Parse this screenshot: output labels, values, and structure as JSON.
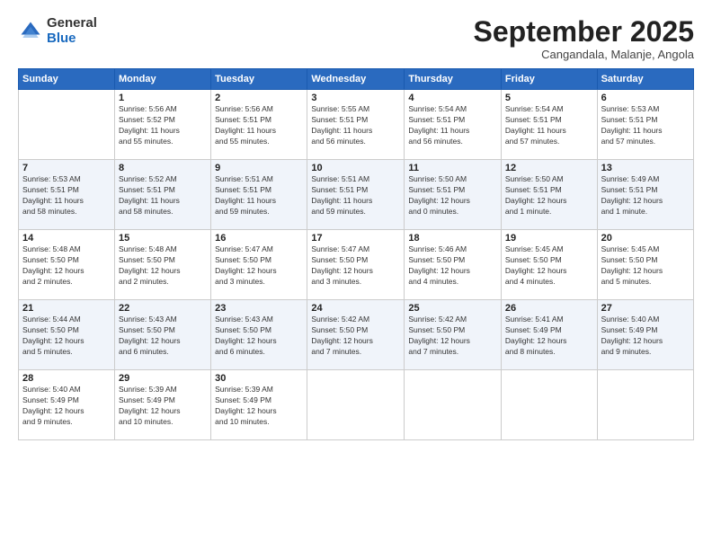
{
  "logo": {
    "general": "General",
    "blue": "Blue"
  },
  "title": "September 2025",
  "subtitle": "Cangandala, Malanje, Angola",
  "days_header": [
    "Sunday",
    "Monday",
    "Tuesday",
    "Wednesday",
    "Thursday",
    "Friday",
    "Saturday"
  ],
  "weeks": [
    [
      {
        "day": "",
        "info": ""
      },
      {
        "day": "1",
        "info": "Sunrise: 5:56 AM\nSunset: 5:52 PM\nDaylight: 11 hours\nand 55 minutes."
      },
      {
        "day": "2",
        "info": "Sunrise: 5:56 AM\nSunset: 5:51 PM\nDaylight: 11 hours\nand 55 minutes."
      },
      {
        "day": "3",
        "info": "Sunrise: 5:55 AM\nSunset: 5:51 PM\nDaylight: 11 hours\nand 56 minutes."
      },
      {
        "day": "4",
        "info": "Sunrise: 5:54 AM\nSunset: 5:51 PM\nDaylight: 11 hours\nand 56 minutes."
      },
      {
        "day": "5",
        "info": "Sunrise: 5:54 AM\nSunset: 5:51 PM\nDaylight: 11 hours\nand 57 minutes."
      },
      {
        "day": "6",
        "info": "Sunrise: 5:53 AM\nSunset: 5:51 PM\nDaylight: 11 hours\nand 57 minutes."
      }
    ],
    [
      {
        "day": "7",
        "info": "Sunrise: 5:53 AM\nSunset: 5:51 PM\nDaylight: 11 hours\nand 58 minutes."
      },
      {
        "day": "8",
        "info": "Sunrise: 5:52 AM\nSunset: 5:51 PM\nDaylight: 11 hours\nand 58 minutes."
      },
      {
        "day": "9",
        "info": "Sunrise: 5:51 AM\nSunset: 5:51 PM\nDaylight: 11 hours\nand 59 minutes."
      },
      {
        "day": "10",
        "info": "Sunrise: 5:51 AM\nSunset: 5:51 PM\nDaylight: 11 hours\nand 59 minutes."
      },
      {
        "day": "11",
        "info": "Sunrise: 5:50 AM\nSunset: 5:51 PM\nDaylight: 12 hours\nand 0 minutes."
      },
      {
        "day": "12",
        "info": "Sunrise: 5:50 AM\nSunset: 5:51 PM\nDaylight: 12 hours\nand 1 minute."
      },
      {
        "day": "13",
        "info": "Sunrise: 5:49 AM\nSunset: 5:51 PM\nDaylight: 12 hours\nand 1 minute."
      }
    ],
    [
      {
        "day": "14",
        "info": "Sunrise: 5:48 AM\nSunset: 5:50 PM\nDaylight: 12 hours\nand 2 minutes."
      },
      {
        "day": "15",
        "info": "Sunrise: 5:48 AM\nSunset: 5:50 PM\nDaylight: 12 hours\nand 2 minutes."
      },
      {
        "day": "16",
        "info": "Sunrise: 5:47 AM\nSunset: 5:50 PM\nDaylight: 12 hours\nand 3 minutes."
      },
      {
        "day": "17",
        "info": "Sunrise: 5:47 AM\nSunset: 5:50 PM\nDaylight: 12 hours\nand 3 minutes."
      },
      {
        "day": "18",
        "info": "Sunrise: 5:46 AM\nSunset: 5:50 PM\nDaylight: 12 hours\nand 4 minutes."
      },
      {
        "day": "19",
        "info": "Sunrise: 5:45 AM\nSunset: 5:50 PM\nDaylight: 12 hours\nand 4 minutes."
      },
      {
        "day": "20",
        "info": "Sunrise: 5:45 AM\nSunset: 5:50 PM\nDaylight: 12 hours\nand 5 minutes."
      }
    ],
    [
      {
        "day": "21",
        "info": "Sunrise: 5:44 AM\nSunset: 5:50 PM\nDaylight: 12 hours\nand 5 minutes."
      },
      {
        "day": "22",
        "info": "Sunrise: 5:43 AM\nSunset: 5:50 PM\nDaylight: 12 hours\nand 6 minutes."
      },
      {
        "day": "23",
        "info": "Sunrise: 5:43 AM\nSunset: 5:50 PM\nDaylight: 12 hours\nand 6 minutes."
      },
      {
        "day": "24",
        "info": "Sunrise: 5:42 AM\nSunset: 5:50 PM\nDaylight: 12 hours\nand 7 minutes."
      },
      {
        "day": "25",
        "info": "Sunrise: 5:42 AM\nSunset: 5:50 PM\nDaylight: 12 hours\nand 7 minutes."
      },
      {
        "day": "26",
        "info": "Sunrise: 5:41 AM\nSunset: 5:49 PM\nDaylight: 12 hours\nand 8 minutes."
      },
      {
        "day": "27",
        "info": "Sunrise: 5:40 AM\nSunset: 5:49 PM\nDaylight: 12 hours\nand 9 minutes."
      }
    ],
    [
      {
        "day": "28",
        "info": "Sunrise: 5:40 AM\nSunset: 5:49 PM\nDaylight: 12 hours\nand 9 minutes."
      },
      {
        "day": "29",
        "info": "Sunrise: 5:39 AM\nSunset: 5:49 PM\nDaylight: 12 hours\nand 10 minutes."
      },
      {
        "day": "30",
        "info": "Sunrise: 5:39 AM\nSunset: 5:49 PM\nDaylight: 12 hours\nand 10 minutes."
      },
      {
        "day": "",
        "info": ""
      },
      {
        "day": "",
        "info": ""
      },
      {
        "day": "",
        "info": ""
      },
      {
        "day": "",
        "info": ""
      }
    ]
  ]
}
